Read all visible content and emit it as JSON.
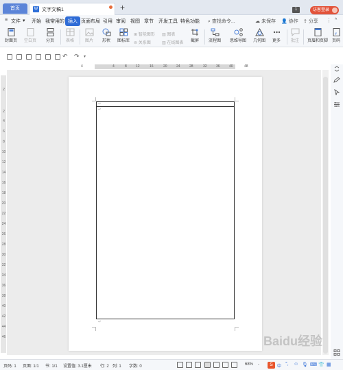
{
  "tabs": {
    "home": "首页",
    "document": "文字文稿1",
    "add": "+"
  },
  "title_right": {
    "page_badge": "1",
    "login": "访客登录"
  },
  "menu": {
    "file": "文件",
    "items": [
      "开始",
      "我常用的",
      "插入",
      "页面布局",
      "引用",
      "审阅",
      "视图",
      "章节",
      "开发工具",
      "特色功能"
    ],
    "active_index": 2,
    "search": "查找命令...",
    "unsaved": "未保存",
    "collab": "协作",
    "share": "分享"
  },
  "ribbon": {
    "cover": "封面页",
    "blank_page": "空白页",
    "page_break": "分页",
    "table": "表格",
    "picture": "图片",
    "shape": "形状",
    "icon_lib": "图标库",
    "smart_art": "智能图形",
    "relation": "关系图",
    "chart": "图表",
    "online_chart": "在线图表",
    "screenshot": "截屏",
    "flowchart": "流程图",
    "mindmap": "思维导图",
    "geometry": "几何图",
    "more": "更多",
    "comment": "批注",
    "header_footer": "页眉和页脚",
    "page_num": "页码"
  },
  "ruler": {
    "marks": [
      "4",
      "4",
      "8",
      "12",
      "16",
      "20",
      "24",
      "28",
      "32",
      "36",
      "40",
      "48"
    ]
  },
  "vruler": {
    "marks": [
      "2",
      "2",
      "4",
      "6",
      "8",
      "10",
      "12",
      "14",
      "16",
      "18",
      "20",
      "22",
      "24",
      "26",
      "28",
      "30",
      "32",
      "34",
      "36",
      "38",
      "40",
      "42",
      "44",
      "46"
    ]
  },
  "document": {
    "para_marks": [
      "↵",
      "↵",
      "↵"
    ]
  },
  "status": {
    "page_num": "页码: 1",
    "pages": "页面: 1/1",
    "section": "节: 1/1",
    "setting": "设置值: 3.1厘米",
    "row": "行: 2",
    "col": "列: 1",
    "words": "字数: 0",
    "zoom": "68%",
    "zoom_minus": "-",
    "ime": "中"
  },
  "watermark": "Baidu经验",
  "colors": {
    "accent": "#2f6cd6",
    "login": "#e2533a",
    "home_tab": "#5b84d8"
  }
}
